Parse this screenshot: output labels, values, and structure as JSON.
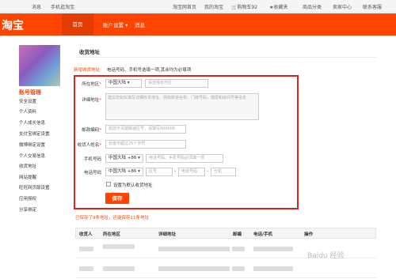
{
  "topbar": {
    "greeting": "淘宝网首页",
    "msg": "消息",
    "mobile": "手机逛淘宝",
    "home": "淘宝网首页",
    "my_taobao": "我的淘宝",
    "cart": "购物车92",
    "favorites": "收藏夹",
    "categories": "商品分类",
    "seller": "卖家中心",
    "service": "联系客服"
  },
  "header": {
    "logo": "淘宝",
    "nav": [
      "首页",
      "账户设置",
      "消息"
    ]
  },
  "sidebar": {
    "title": "账号管理",
    "items": [
      "安全设置",
      "个人资料",
      "个人成长信息",
      "支付宝绑定设置",
      "微博绑定设置",
      "个人交易信息",
      "收货地址",
      "网站提醒",
      "旺旺网页版设置",
      "应用授权",
      "分享绑定"
    ]
  },
  "section": {
    "title": "收货地址",
    "tip_new": "新增收货地址",
    "tip_rule": "电话号码、手机号选填一项,其余均为必填项"
  },
  "form": {
    "region_label": "所在地区",
    "region_country": "中国大陆",
    "region_placeholder": "请选择省市区",
    "address_label": "详细地址",
    "address_placeholder": "建议您如实填写详细收货地址，例如街道名称，门牌号码，楼层和房间号等信息",
    "zip_label": "邮政编码",
    "zip_placeholder": "如您不清楚邮递区号，请填写000000",
    "name_label": "收货人姓名",
    "name_placeholder": "长度不超过25个字符",
    "mobile_label": "手机号码",
    "mobile_country": "中国大陆 +86",
    "mobile_placeholder": "电话号码、手机号码必须填一项",
    "phone_label": "电话号码",
    "phone_country": "中国大陆 +86",
    "phone_area": "区号",
    "phone_number": "电话号码",
    "phone_ext": "分机",
    "default_label": "设置为默认收货地址",
    "save_label": "保存"
  },
  "saved_note": "已保存了9条地址，还能保存11条地址",
  "table": {
    "headers": [
      "收货人",
      "所在地区",
      "详细地址",
      "邮编",
      "电话/手机",
      "操作"
    ]
  },
  "watermark": "Baidu 经验"
}
